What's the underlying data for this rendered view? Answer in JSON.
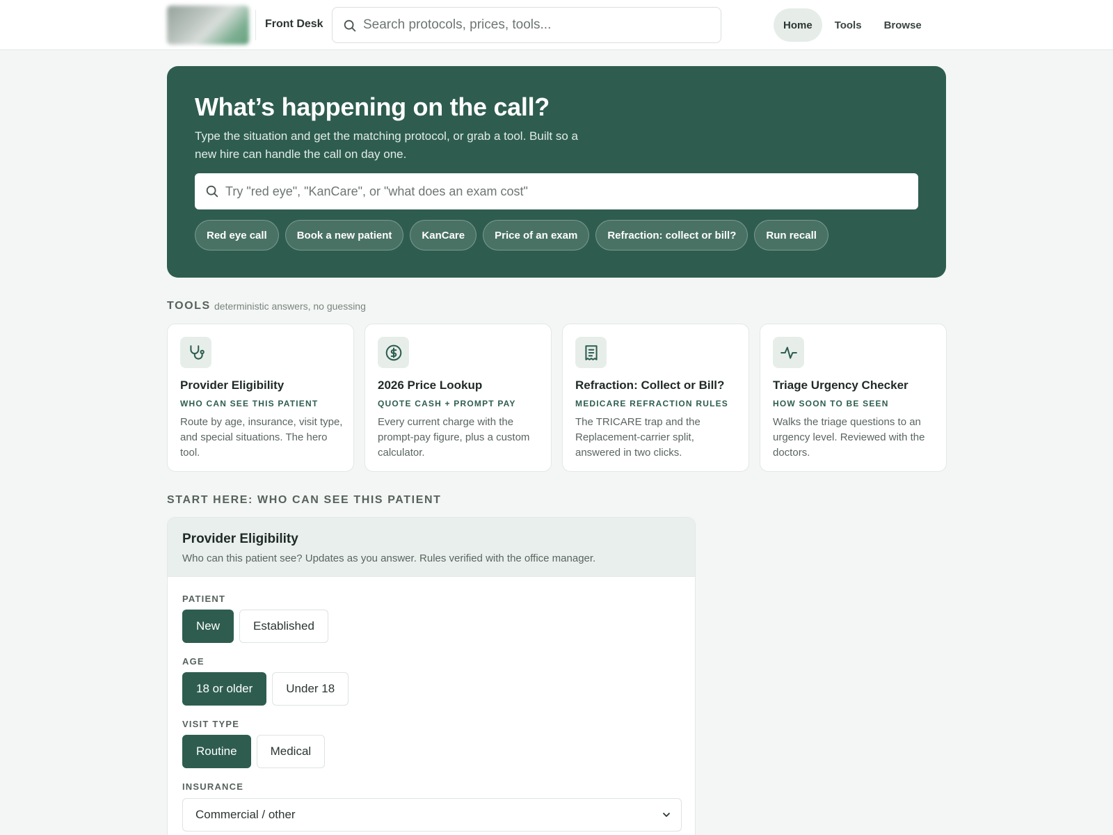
{
  "header": {
    "brand": "Front Desk",
    "search_placeholder": "Search protocols, prices, tools...",
    "nav": [
      {
        "label": "Home",
        "active": true
      },
      {
        "label": "Tools",
        "active": false
      },
      {
        "label": "Browse",
        "active": false
      }
    ]
  },
  "hero": {
    "title": "What’s happening on the call?",
    "subtitle": "Type the situation and get the matching protocol, or grab a tool. Built so a new hire can handle the call on day one.",
    "search_placeholder": "Try \"red eye\", \"KanCare\", or \"what does an exam cost\"",
    "chips": [
      "Red eye call",
      "Book a new patient",
      "KanCare",
      "Price of an exam",
      "Refraction: collect or bill?",
      "Run recall"
    ]
  },
  "tools": {
    "label": "TOOLS",
    "note": "deterministic answers, no guessing",
    "cards": [
      {
        "icon": "stethoscope-icon",
        "title": "Provider Eligibility",
        "kicker": "WHO CAN SEE THIS PATIENT",
        "desc": "Route by age, insurance, visit type, and special situations. The hero tool."
      },
      {
        "icon": "dollar-circle-icon",
        "title": "2026 Price Lookup",
        "kicker": "QUOTE CASH + PROMPT PAY",
        "desc": "Every current charge with the prompt-pay figure, plus a custom calculator."
      },
      {
        "icon": "receipt-icon",
        "title": "Refraction: Collect or Bill?",
        "kicker": "MEDICARE REFRACTION RULES",
        "desc": "The TRICARE trap and the Replacement-carrier split, answered in two clicks."
      },
      {
        "icon": "pulse-icon",
        "title": "Triage Urgency Checker",
        "kicker": "HOW SOON TO BE SEEN",
        "desc": "Walks the triage questions to an urgency level. Reviewed with the doctors."
      }
    ]
  },
  "start": {
    "label": "START HERE: WHO CAN SEE THIS PATIENT",
    "panel_title": "Provider Eligibility",
    "panel_subtitle": "Who can this patient see? Updates as you answer. Rules verified with the office manager.",
    "patient": {
      "label": "PATIENT",
      "options": [
        "New",
        "Established"
      ],
      "selected": "New"
    },
    "age": {
      "label": "AGE",
      "options": [
        "18 or older",
        "Under 18"
      ],
      "selected": "18 or older"
    },
    "visit_type": {
      "label": "VISIT TYPE",
      "options": [
        "Routine",
        "Medical"
      ],
      "selected": "Routine"
    },
    "insurance": {
      "label": "INSURANCE",
      "value": "Commercial / other"
    }
  },
  "colors": {
    "accent": "#2e5d4f",
    "background": "#f3f6f4"
  }
}
